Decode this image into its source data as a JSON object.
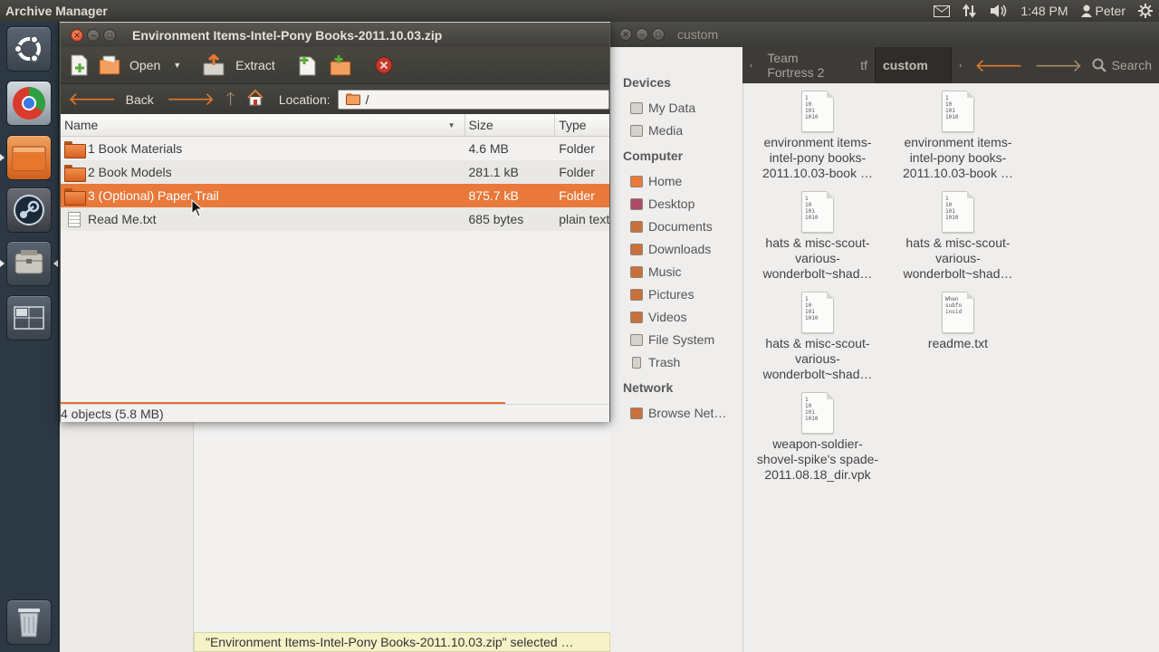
{
  "top_panel": {
    "app_title": "Archive Manager",
    "time": "1:48 PM",
    "user": "Peter",
    "indicators": [
      "mail-icon",
      "network-icon",
      "volume-icon",
      "user-icon",
      "gear-icon"
    ]
  },
  "launcher": {
    "items": [
      "ubuntu-dash-icon",
      "chrome-icon",
      "files-icon",
      "steam-icon",
      "archive-manager-icon",
      "workspace-switcher-icon",
      "trash-icon"
    ]
  },
  "file_manager": {
    "title": "custom",
    "breadcrumbs": [
      "Team Fortress 2",
      "tf",
      "custom"
    ],
    "search_label": "Search",
    "sidebar": {
      "devices_header": "Devices",
      "devices": [
        "My Data",
        "Media"
      ],
      "computer_header": "Computer",
      "computer": [
        "Home",
        "Desktop",
        "Documents",
        "Downloads",
        "Music",
        "Pictures",
        "Videos",
        "File System",
        "Trash"
      ],
      "network_header": "Network",
      "network": [
        "Browse Net…"
      ]
    },
    "files": [
      {
        "label": "environment items-intel-pony books-2011.10.03-book …",
        "glyph": "1\n10\n101\n1010"
      },
      {
        "label": "environment items-intel-pony books-2011.10.03-book …",
        "glyph": "1\n10\n101\n1010"
      },
      {
        "label": "hats & misc-scout-various-wonderbolt~shad…",
        "glyph": "1\n10\n101\n1010"
      },
      {
        "label": "hats & misc-scout-various-wonderbolt~shad…",
        "glyph": "1\n10\n101\n1010"
      },
      {
        "label": "hats & misc-scout-various-wonderbolt~shad…",
        "glyph": "1\n10\n101\n1010"
      },
      {
        "label": "readme.txt",
        "glyph": "When\nsubfo\ninsid"
      },
      {
        "label": "weapon-soldier-shovel-spike's spade-2011.08.18_dir.vpk",
        "glyph": "1\n10\n101\n1010"
      }
    ],
    "status_tip": "\"Environment Items-Intel-Pony Books-2011.10.03.zip\" selected …"
  },
  "archive_manager": {
    "title": "Environment Items-Intel-Pony Books-2011.10.03.zip",
    "toolbar": {
      "open_label": "Open",
      "extract_label": "Extract"
    },
    "locbar": {
      "back_label": "Back",
      "location_label": "Location:",
      "location_value": "/"
    },
    "columns": {
      "name": "Name",
      "size": "Size",
      "type": "Type"
    },
    "rows": [
      {
        "name": "1 Book Materials",
        "size": "4.6 MB",
        "type": "Folder",
        "kind": "folder"
      },
      {
        "name": "2 Book Models",
        "size": "281.1 kB",
        "type": "Folder",
        "kind": "folder"
      },
      {
        "name": "3 (Optional) Paper Trail",
        "size": "875.7 kB",
        "type": "Folder",
        "kind": "folder",
        "selected": true
      },
      {
        "name": "Read Me.txt",
        "size": "685 bytes",
        "type": "plain text document",
        "kind": "text"
      }
    ],
    "status": "4 objects (5.8 MB)",
    "progress_fraction": 0.81
  }
}
